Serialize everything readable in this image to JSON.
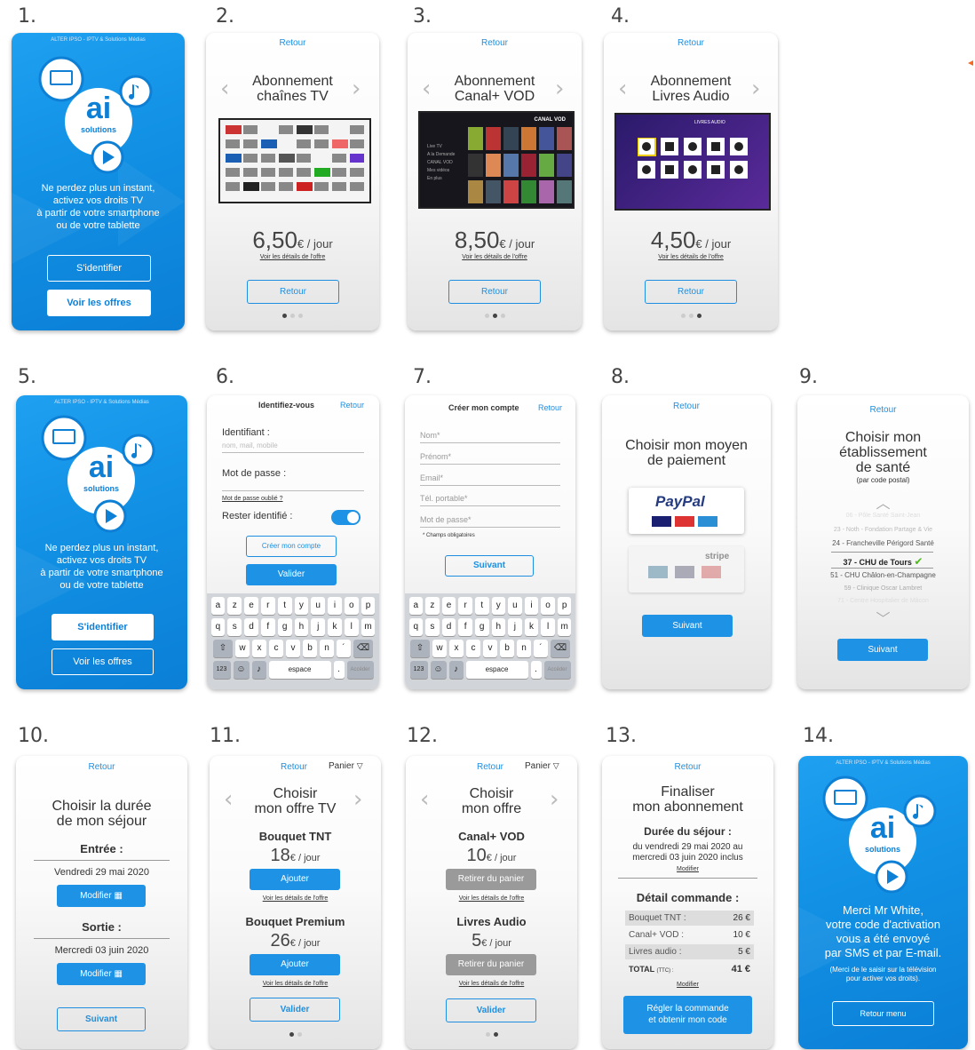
{
  "nums": [
    "1.",
    "2.",
    "3.",
    "4.",
    "5.",
    "6.",
    "7.",
    "8.",
    "9.",
    "10.",
    "11.",
    "12.",
    "13.",
    "14."
  ],
  "brand": {
    "header": "ALTER IPSO - IPTV & Solutions Médias",
    "logo": "ai",
    "logo_sub": "solutions",
    "tagline": [
      "Ne perdez plus un instant,",
      "activez vos droits TV",
      "à partir de votre smartphone",
      "ou de votre tablette"
    ],
    "btn_login": "S'identifier",
    "btn_offers": "Voir les offres"
  },
  "common": {
    "back": "Retour",
    "details": "Voir les détails de l'offre",
    "next": "Suivant",
    "validate": "Valider",
    "modify": "Modifier",
    "cart": "Panier"
  },
  "s2": {
    "title1": "Abonnement",
    "title2": "chaînes TV",
    "price": "6,50",
    "unit": "€ / jour"
  },
  "s3": {
    "title1": "Abonnement",
    "title2": "Canal+ VOD",
    "price": "8,50",
    "unit": "€ / jour",
    "screen_label": "CANAL VOD",
    "menu": [
      "Live TV",
      "A la Demande",
      "CANAL VOD",
      "Mes vidéos",
      "En plus"
    ]
  },
  "s4": {
    "title1": "Abonnement",
    "title2": "Livres Audio",
    "price": "4,50",
    "unit": "€ / jour",
    "screen_label": "LIVRES AUDIO"
  },
  "s6": {
    "title": "Identifiez-vous",
    "id_label": "Identifiant :",
    "id_placeholder": "nom, mail, mobile",
    "pwd_label": "Mot de passe :",
    "forgot": "Mot de passe oublié ?",
    "stay": "Rester identifié :",
    "create": "Créer mon compte"
  },
  "s7": {
    "title": "Créer mon compte",
    "fields": [
      "Nom*",
      "Prénom*",
      "Email*",
      "Tél. portable*",
      "Mot de passe*"
    ],
    "required": "* Champs obligatoires"
  },
  "keyboard": {
    "row1": [
      "a",
      "z",
      "e",
      "r",
      "t",
      "y",
      "u",
      "i",
      "o",
      "p"
    ],
    "row2": [
      "q",
      "s",
      "d",
      "f",
      "g",
      "h",
      "j",
      "k",
      "l",
      "m"
    ],
    "row3": [
      "w",
      "x",
      "c",
      "v",
      "b",
      "n",
      "´"
    ],
    "num": "123",
    "space": "espace",
    "go": "Accéder"
  },
  "s8": {
    "title1": "Choisir mon moyen",
    "title2": "de paiement",
    "paypal": "PayPal",
    "stripe": "stripe"
  },
  "s9": {
    "title1": "Choisir mon",
    "title2": "établissement",
    "title3": "de santé",
    "sub": "(par code postal)",
    "items": [
      "06 - Pôle Santé Saint-Jean",
      "23 - Noth - Fondation Partage & Vie",
      "24 - Francheville Périgord Santé",
      "37 - CHU de Tours",
      "51 - CHU Châlon-en-Champagne",
      "59 - Clinique Oscar Lambret",
      "71 - Centre Hospitalier de Mâcon"
    ]
  },
  "s10": {
    "title1": "Choisir la durée",
    "title2": "de mon séjour",
    "in_label": "Entrée :",
    "in_date": "Vendredi 29 mai 2020",
    "out_label": "Sortie :",
    "out_date": "Mercredi 03 juin 2020"
  },
  "s11": {
    "title1": "Choisir",
    "title2": "mon offre TV",
    "o1": "Bouquet TNT",
    "p1": "18",
    "o2": "Bouquet Premium",
    "p2": "26",
    "unit": "€ / jour",
    "add": "Ajouter"
  },
  "s12": {
    "title1": "Choisir",
    "title2": "mon offre",
    "o1": "Canal+ VOD",
    "p1": "10",
    "o2": "Livres Audio",
    "p2": "5",
    "unit": "€ / jour",
    "remove": "Retirer du panier"
  },
  "s13": {
    "title1": "Finaliser",
    "title2": "mon abonnement",
    "stay_label": "Durée du séjour :",
    "stay_text1": "du vendredi 29 mai 2020 au",
    "stay_text2": "mercredi 03 juin 2020 inclus",
    "detail": "Détail commande :",
    "rows": [
      {
        "k": "Bouquet TNT :",
        "v": "26 €"
      },
      {
        "k": "Canal+ VOD :",
        "v": "10 €"
      },
      {
        "k": "Livres audio :",
        "v": "5 €"
      }
    ],
    "total_k": "TOTAL",
    "total_ttc": "(TTC) :",
    "total_v": "41 €",
    "pay1": "Régler la commande",
    "pay2": "et obtenir mon code"
  },
  "s14": {
    "msg": [
      "Merci Mr White,",
      "votre code d'activation",
      "vous a été envoyé",
      "par SMS et par E-mail."
    ],
    "note": [
      "(Merci de le saisir sur la télévision",
      "pour activer vos droits)."
    ],
    "btn": "Retour menu"
  },
  "colors": {
    "blue": "#1e93e5",
    "brand_blue": "#1190e4",
    "green": "#4cbb17"
  }
}
